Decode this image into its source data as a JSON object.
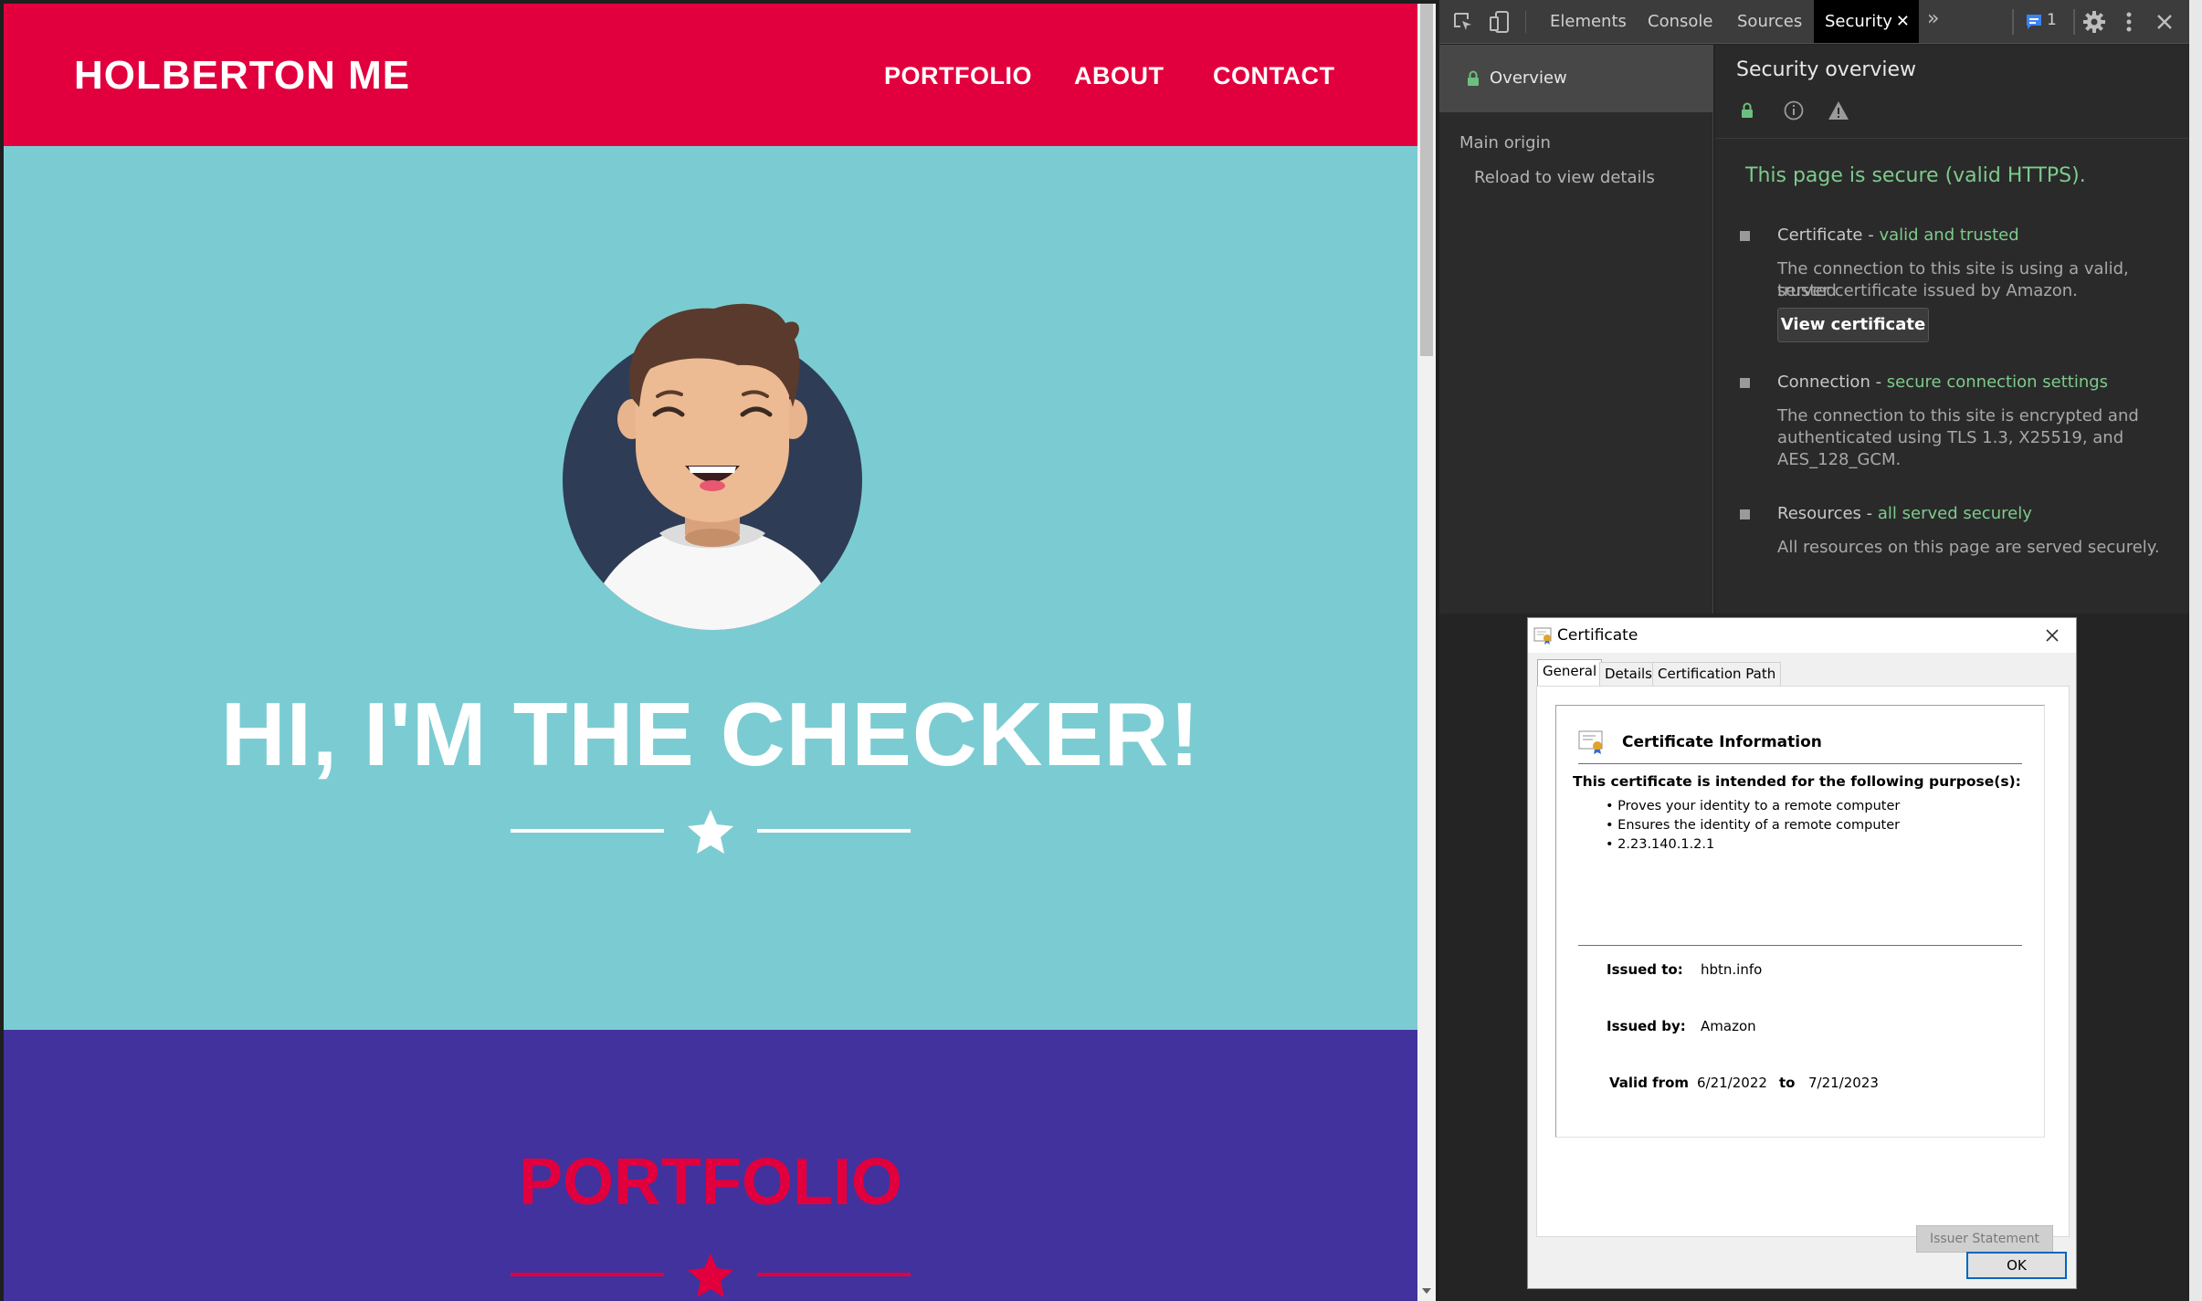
{
  "site": {
    "brand": "HOLBERTON ME",
    "nav": [
      "PORTFOLIO",
      "ABOUT",
      "CONTACT"
    ],
    "hero_title": "HI, I'M THE CHECKER!",
    "portfolio_title": "PORTFOLIO",
    "colors": {
      "header": "#e1003d",
      "hero": "#7bccd2",
      "portfolio": "#41329e"
    }
  },
  "devtools": {
    "tabs": [
      "Elements",
      "Console",
      "Sources",
      "Security"
    ],
    "active_tab": "Security",
    "issues_count": "1",
    "sidebar": {
      "overview": "Overview",
      "main_origin": "Main origin",
      "reload_hint": "Reload to view details"
    },
    "main": {
      "title": "Security overview",
      "secure_message": "This page is secure (valid HTTPS).",
      "certificate_label": "Certificate - ",
      "certificate_status": "valid and trusted",
      "certificate_desc_1": "The connection to this site is using a valid, trusted",
      "certificate_desc_2": "server certificate issued by Amazon.",
      "view_certificate": "View certificate",
      "connection_label": "Connection - ",
      "connection_status": "secure connection settings",
      "connection_desc_1": "The connection to this site is encrypted and",
      "connection_desc_2": "authenticated using TLS 1.3, X25519, and",
      "connection_desc_3": "AES_128_GCM.",
      "resources_label": "Resources - ",
      "resources_status": "all served securely",
      "resources_desc": "All resources on this page are served securely."
    }
  },
  "certificate": {
    "title": "Certificate",
    "tabs": [
      "General",
      "Details",
      "Certification Path"
    ],
    "info_heading": "Certificate Information",
    "purpose_heading": "This certificate is intended for the following purpose(s):",
    "purposes": [
      "• Proves your identity to a remote computer",
      "• Ensures the identity of a remote computer",
      "• 2.23.140.1.2.1"
    ],
    "issued_to_label": "Issued to:",
    "issued_to": "hbtn.info",
    "issued_by_label": "Issued by:",
    "issued_by": "Amazon",
    "valid_from_label": "Valid from",
    "valid_from": "6/21/2022",
    "to_label": "to",
    "valid_to": "7/21/2023",
    "issuer_statement": "Issuer Statement",
    "ok": "OK"
  }
}
